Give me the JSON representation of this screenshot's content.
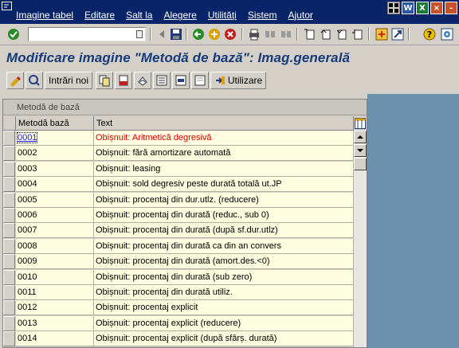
{
  "menu": {
    "items": [
      "Imagine tabel",
      "Editare",
      "Salt la",
      "Alegere",
      "Utilități",
      "Sistem",
      "Ajutor"
    ]
  },
  "title": "Modificare imagine \"Metodă de bază\": Imag.generală",
  "app_toolbar": {
    "new_entries_label": "Intrări noi",
    "utilities_label": "Utilizare"
  },
  "table": {
    "title": "Metodă de bază",
    "columns": [
      "Metodă bază",
      "Text"
    ],
    "rows": [
      {
        "code": "0001",
        "text": "Obișnuit: Aritmetică degresivă"
      },
      {
        "code": "0002",
        "text": "Obișnuit: fără amortizare automată"
      },
      {
        "code": "0003",
        "text": "Obișnuit: leasing"
      },
      {
        "code": "0004",
        "text": "Obișnuit: sold degresiv peste durată totală ut.JP"
      },
      {
        "code": "0005",
        "text": "Obișnuit: procentaj din dur.utlz. (reducere)"
      },
      {
        "code": "0006",
        "text": "Obișnuit: procentaj din durată (reduc., sub 0)"
      },
      {
        "code": "0007",
        "text": "Obișnuit: procentaj din durată (după sf.dur.utlz)"
      },
      {
        "code": "0008",
        "text": "Obișnuit: procentaj din durată ca din an convers"
      },
      {
        "code": "0009",
        "text": "Obișnuit: procentaj din durată (amort.des.<0)"
      },
      {
        "code": "0010",
        "text": "Obișnuit: procentaj din durată (sub zero)"
      },
      {
        "code": "0011",
        "text": "Obișnuit: procentaj din durată utiliz."
      },
      {
        "code": "0012",
        "text": "Obișnuit: procentaj explicit"
      },
      {
        "code": "0013",
        "text": "Obișnuit: procentaj explicit (reducere)"
      },
      {
        "code": "0014",
        "text": "Obișnuit: procentaj explicit (după sfârș. durată)"
      }
    ]
  },
  "colors": {
    "menubar": "#0a246a",
    "title": "#173a7a",
    "panel": "#6b90ad",
    "row_bg": "#fffde0",
    "active_text": "#e00000"
  }
}
